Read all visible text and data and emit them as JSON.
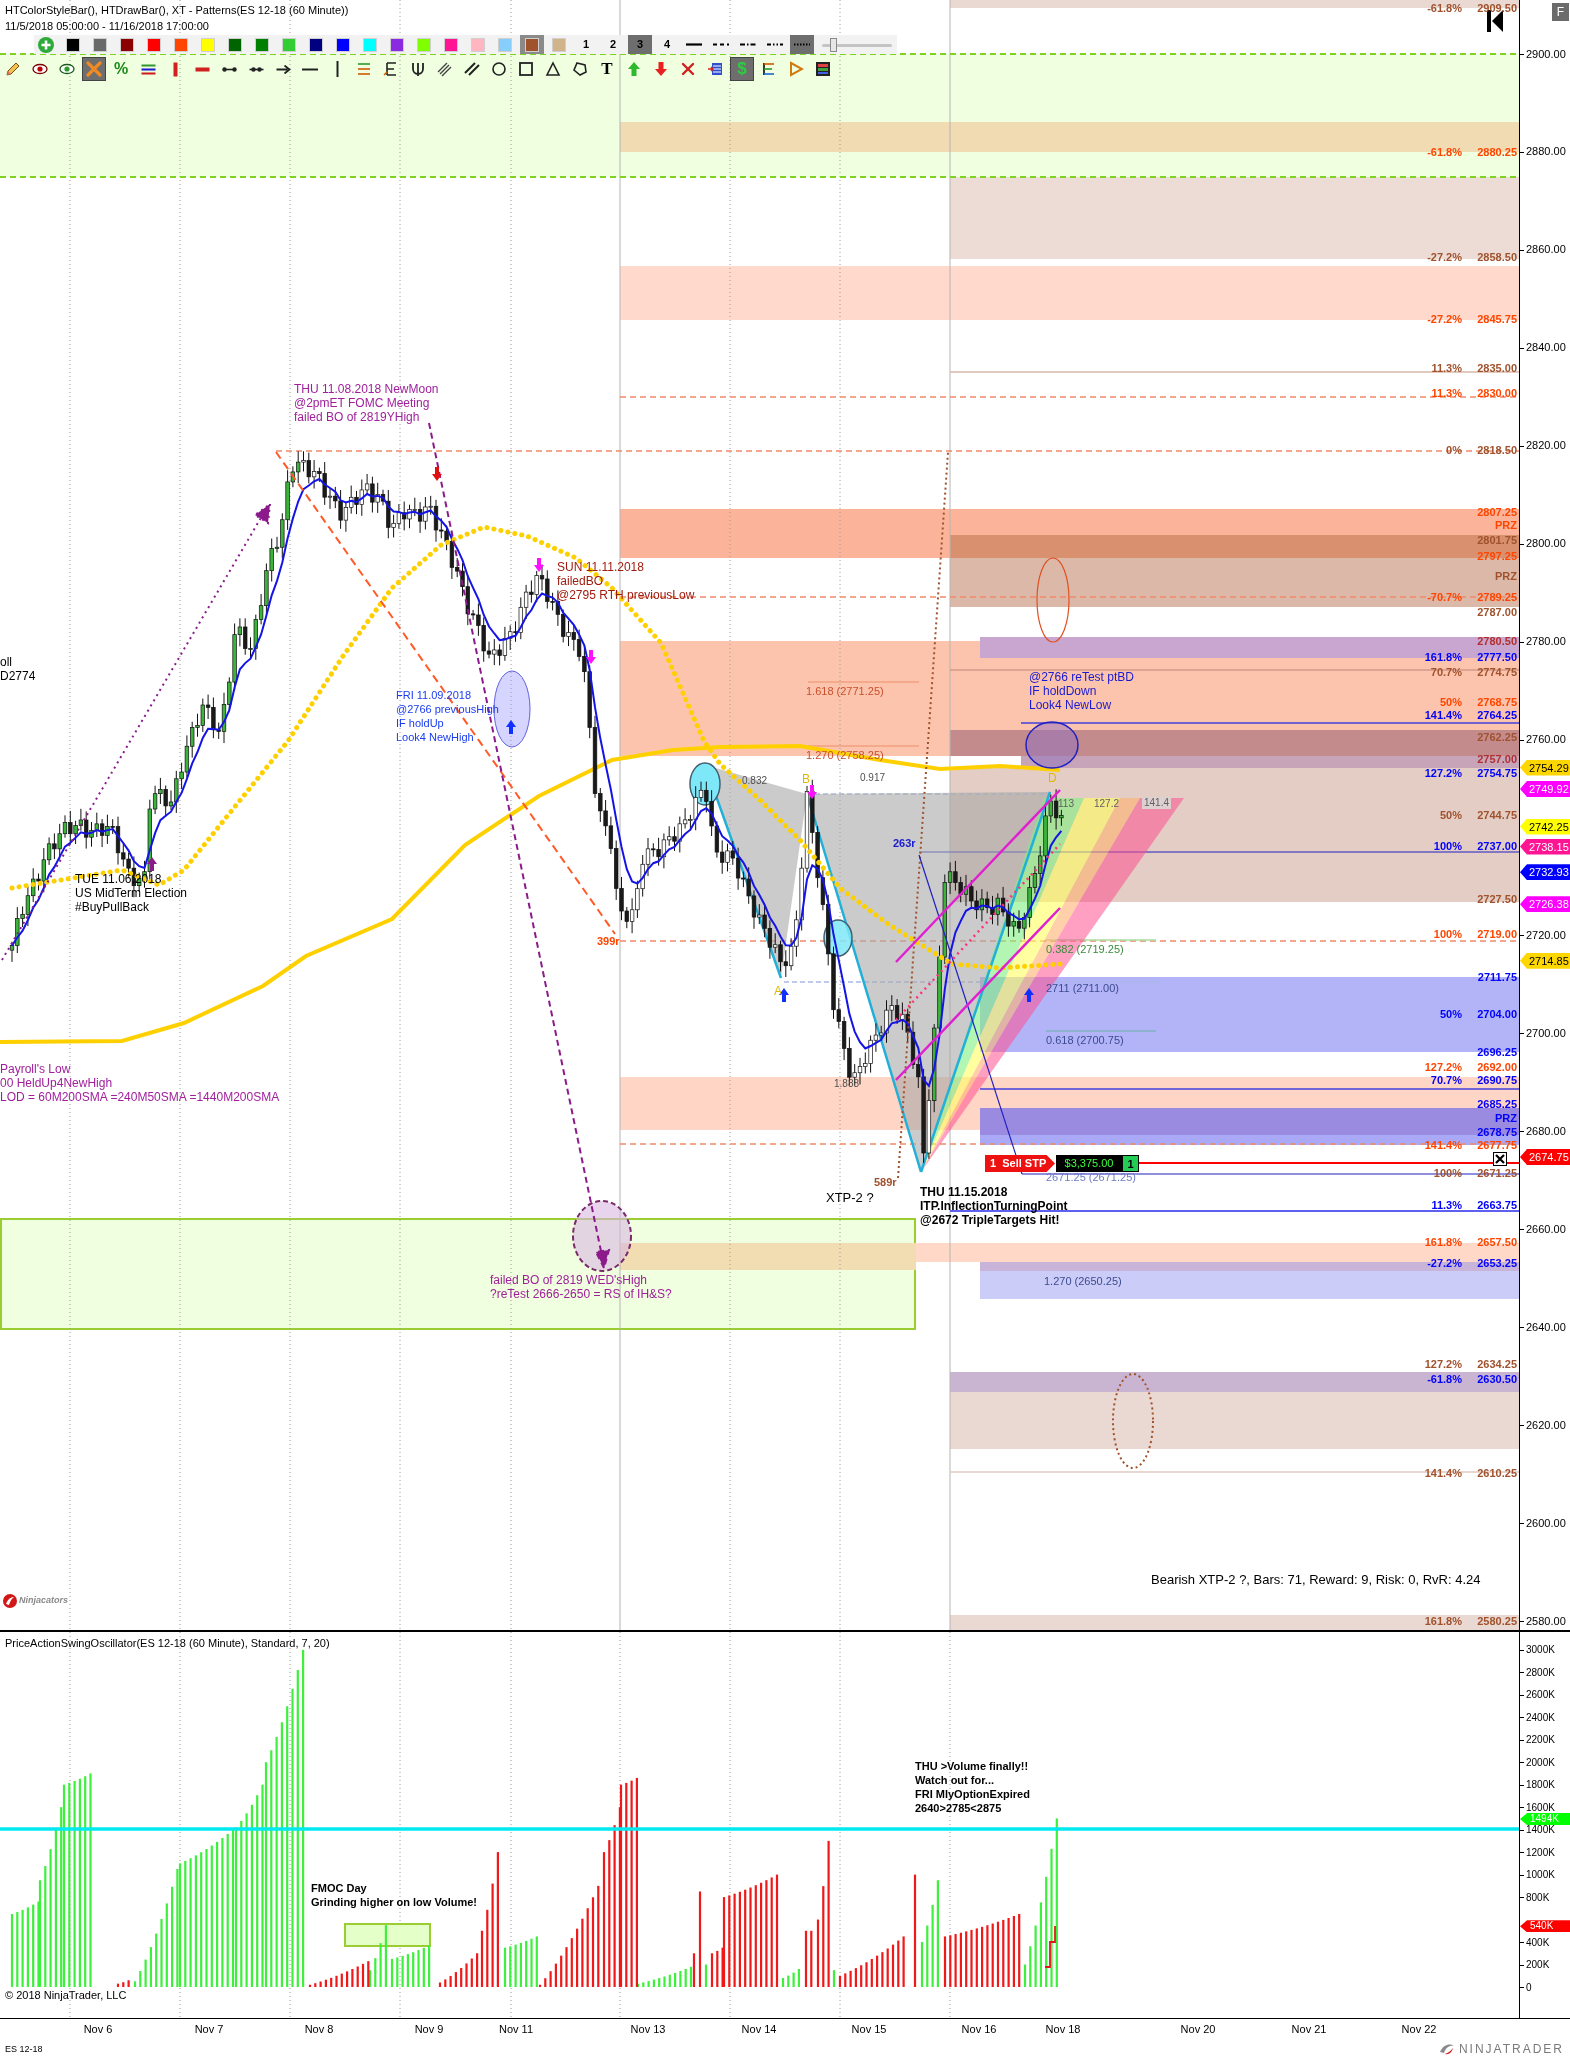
{
  "header": {
    "indicators": "HTColorStyleBar(), HTDrawBar(), XT - Patterns(ES 12-18 (60 Minute))",
    "range": "11/5/2018 05:00:00 - 11/16/2018 17:00:00"
  },
  "toolbar": {
    "swatches": [
      {
        "color": "#000000",
        "selected": false
      },
      {
        "color": "#696969",
        "selected": false
      },
      {
        "color": "#8b0000",
        "selected": false
      },
      {
        "color": "#ff0000",
        "selected": false
      },
      {
        "color": "#ff4500",
        "selected": false
      },
      {
        "color": "#ffff00",
        "selected": false
      },
      {
        "color": "#006400",
        "selected": false
      },
      {
        "color": "#008000",
        "selected": false
      },
      {
        "color": "#32cd32",
        "selected": false
      },
      {
        "color": "#000080",
        "selected": false
      },
      {
        "color": "#0000ff",
        "selected": false
      },
      {
        "color": "#00ffff",
        "selected": false
      },
      {
        "color": "#8a2be2",
        "selected": false
      },
      {
        "color": "#7fff00",
        "selected": false
      },
      {
        "color": "#ff1493",
        "selected": false
      },
      {
        "color": "#ffb6c1",
        "selected": false
      },
      {
        "color": "#87cefa",
        "selected": false
      },
      {
        "color": "#a0522d",
        "selected": true
      },
      {
        "color": "#d2b48c",
        "selected": false
      }
    ],
    "widths": [
      {
        "label": "1",
        "selected": false
      },
      {
        "label": "2",
        "selected": false
      },
      {
        "label": "3",
        "selected": true
      },
      {
        "label": "4",
        "selected": false
      }
    ],
    "line_styles": [
      {
        "kind": "solid",
        "selected": false
      },
      {
        "kind": "dash",
        "selected": false
      },
      {
        "kind": "dashdot",
        "selected": false
      },
      {
        "kind": "dashdotdot",
        "selected": false
      },
      {
        "kind": "dot",
        "selected": true
      }
    ],
    "size_slider": {
      "level": 0.15
    },
    "tools": [
      {
        "kind": "pencil",
        "selected": false
      },
      {
        "kind": "hide",
        "selected": false
      },
      {
        "kind": "show",
        "selected": false
      },
      {
        "kind": "erase",
        "selected": true
      },
      {
        "kind": "percent",
        "label": "%",
        "selected": false
      },
      {
        "kind": "bands",
        "selected": false
      },
      {
        "kind": "vbar",
        "selected": false
      },
      {
        "kind": "hbar",
        "selected": false
      },
      {
        "kind": "segment",
        "selected": false
      },
      {
        "kind": "extended",
        "selected": false
      },
      {
        "kind": "arrow",
        "selected": false
      },
      {
        "kind": "hline",
        "selected": false
      },
      {
        "kind": "vline",
        "selected": false
      },
      {
        "kind": "fib",
        "selected": false
      },
      {
        "kind": "fibext",
        "selected": false
      },
      {
        "kind": "pitchfork",
        "selected": false
      },
      {
        "kind": "triplelines",
        "selected": false
      },
      {
        "kind": "parallel",
        "selected": false
      },
      {
        "kind": "circle",
        "selected": false
      },
      {
        "kind": "square",
        "selected": false
      },
      {
        "kind": "triangle",
        "selected": false
      },
      {
        "kind": "polygon",
        "selected": false
      },
      {
        "kind": "text",
        "label": "T",
        "selected": false
      },
      {
        "kind": "uparrow",
        "selected": false
      },
      {
        "kind": "downarrow",
        "selected": false
      },
      {
        "kind": "remove",
        "selected": false
      },
      {
        "kind": "region",
        "selected": false
      },
      {
        "kind": "dollar",
        "label": "$",
        "selected": true
      },
      {
        "kind": "etime",
        "selected": false
      },
      {
        "kind": "play",
        "selected": false
      },
      {
        "kind": "gradient",
        "selected": false
      }
    ]
  },
  "top_right": {
    "panel_button": "F"
  },
  "chart": {
    "annotations": [
      {
        "lines": [
          "THU 11.08.2018 NewMoon",
          "@2pmET FOMC Meeting",
          "failed BO of 2819YHigh"
        ],
        "color": "#a0209c"
      },
      {
        "lines": [
          "SUN 11.11.2018",
          "failedBO",
          "@2795 RTH previousLow"
        ],
        "color": "#a01c10"
      },
      {
        "lines": [
          "FRI 11.09.2018",
          "@2766 previousHigh",
          "IF holdUp",
          "Look4 NewHigh"
        ],
        "color": "#1a3cf0"
      },
      {
        "lines": [
          "TUE 11.06.2018",
          "US MidTerm Election",
          "#BuyPullBack"
        ],
        "color": "#000000"
      },
      {
        "lines": [
          "oll",
          "D2774"
        ],
        "color": "#000000"
      },
      {
        "lines": [
          "Payroll's Low",
          "00 HeldUp4NewHigh",
          "LOD = 60M200SMA =240M50SMA =1440M200SMA"
        ],
        "color": "#a0209c"
      },
      {
        "lines": [
          "failed BO of 2819 WED'sHigh",
          "?reTest 2666-2650 = RS of IH&S?"
        ],
        "color": "#a0209c"
      },
      {
        "lines": [
          "399r"
        ],
        "color": "#ff4500"
      },
      {
        "lines": [
          "@2766 reTest ptBD",
          "IF holdDown",
          "Look4 NewLow"
        ],
        "color": "#1a1ad0"
      },
      {
        "lines": [
          "263r"
        ],
        "color": "#1a1ad0"
      },
      {
        "lines": [
          "589r"
        ],
        "color": "#a0522d"
      },
      {
        "lines": [
          "XTP-2 ?"
        ],
        "color": "#000000"
      },
      {
        "lines": [
          "THU 11.15.2018",
          "ITP.InflectionTurningPoint",
          "@2672 TripleTargets Hit!"
        ],
        "color": "#000000"
      }
    ],
    "pattern_points": [
      "B",
      "A",
      "D"
    ],
    "pattern_ratios": [
      "0.832",
      "0.917",
      "1.888"
    ],
    "pattern_fibs": [
      {
        "text": "1.618 (2771.25)",
        "color": "#c8502a"
      },
      {
        "text": "1.270 (2758.25)",
        "color": "#c8502a"
      },
      {
        "text": "0.382 (2719.25)",
        "color": "#3c8a3c"
      },
      {
        "text": "2711 (2711.00)",
        "color": "#3c4c90"
      },
      {
        "text": "0.618 (2700.75)",
        "color": "#3c4c90"
      },
      {
        "text": "2671.25 (2671.25)",
        "color": "#6c7cc0"
      },
      {
        "text": "1.270 (2650.25)",
        "color": "#3c4c90"
      }
    ],
    "extensions": [
      "113",
      "127.2",
      "141.4"
    ],
    "order": {
      "quantity": "1",
      "action": "Sell STP",
      "value": "$3,375.00",
      "filled": "1"
    },
    "fib_levels": [
      {
        "kind": "level",
        "percent": "-61.8%",
        "price": "2909.50",
        "color": "#a0522d"
      },
      {
        "kind": "level",
        "percent": "-61.8%",
        "price": "2880.25",
        "color": "#ff4500"
      },
      {
        "kind": "level",
        "percent": "-27.2%",
        "price": "2858.50",
        "color": "#a0522d"
      },
      {
        "kind": "level",
        "percent": "-27.2%",
        "price": "2845.75",
        "color": "#ff4500"
      },
      {
        "kind": "level",
        "percent": "11.3%",
        "price": "2835.00",
        "color": "#a0522d"
      },
      {
        "kind": "level",
        "percent": "11.3%",
        "price": "2830.00",
        "color": "#ff4500"
      },
      {
        "kind": "level",
        "percent": "0%",
        "price": "2818.50",
        "color": "#a0522d"
      },
      {
        "kind": "level",
        "price": "2807.25",
        "color": "#ff4500"
      },
      {
        "kind": "tag",
        "text": "PRZ",
        "color": "#ff4500"
      },
      {
        "kind": "level",
        "price": "2801.75",
        "color": "#a0522d"
      },
      {
        "kind": "level",
        "price": "2797.25",
        "color": "#ff4500"
      },
      {
        "kind": "tag",
        "text": "PRZ",
        "color": "#a0522d"
      },
      {
        "kind": "level",
        "percent": "-70.7%",
        "price": "2789.25",
        "color": "#ff4500"
      },
      {
        "kind": "level",
        "price": "2787.00",
        "color": "#a0522d"
      },
      {
        "kind": "level",
        "price": "2780.50",
        "color": "#b03030"
      },
      {
        "kind": "level",
        "percent": "161.8%",
        "price": "2777.50",
        "color": "#0000ff"
      },
      {
        "kind": "level",
        "percent": "70.7%",
        "price": "2774.75",
        "color": "#a0522d"
      },
      {
        "kind": "level",
        "percent": "50%",
        "price": "2768.75",
        "color": "#ff4500"
      },
      {
        "kind": "level",
        "percent": "141.4%",
        "price": "2764.25",
        "color": "#0000ff"
      },
      {
        "kind": "level",
        "price": "2762.25",
        "color": "#a0522d"
      },
      {
        "kind": "level",
        "price": "2757.00",
        "color": "#b03030"
      },
      {
        "kind": "level",
        "percent": "127.2%",
        "price": "2754.75",
        "color": "#0000ff"
      },
      {
        "kind": "level",
        "percent": "50%",
        "price": "2744.75",
        "color": "#a0522d"
      },
      {
        "kind": "level",
        "percent": "100%",
        "price": "2737.00",
        "color": "#0000ff"
      },
      {
        "kind": "level",
        "price": "2727.50",
        "color": "#a0522d"
      },
      {
        "kind": "level",
        "percent": "100%",
        "price": "2719.00",
        "color": "#ff4500"
      },
      {
        "kind": "level",
        "price": "2711.75",
        "color": "#0000ff"
      },
      {
        "kind": "level",
        "percent": "50%",
        "price": "2704.00",
        "color": "#0000ff"
      },
      {
        "kind": "level",
        "price": "2696.25",
        "color": "#0000ff"
      },
      {
        "kind": "level",
        "percent": "127.2%",
        "price": "2692.00",
        "color": "#ff4500"
      },
      {
        "kind": "level",
        "percent": "70.7%",
        "price": "2690.75",
        "color": "#0000ff"
      },
      {
        "kind": "level",
        "price": "2685.25",
        "color": "#0000ff"
      },
      {
        "kind": "tag",
        "text": "PRZ",
        "color": "#0000ff"
      },
      {
        "kind": "level",
        "price": "2678.75",
        "color": "#0000ff"
      },
      {
        "kind": "level",
        "percent": "141.4%",
        "price": "2677.75",
        "color": "#ff4500"
      },
      {
        "kind": "level",
        "percent": "100%",
        "price": "2671.25",
        "color": "#a0522d"
      },
      {
        "kind": "level",
        "percent": "11.3%",
        "price": "2663.75",
        "color": "#0000ff"
      },
      {
        "kind": "level",
        "percent": "161.8%",
        "price": "2657.50",
        "color": "#ff4500"
      },
      {
        "kind": "level",
        "percent": "-27.2%",
        "price": "2653.25",
        "color": "#0000ff"
      },
      {
        "kind": "level",
        "percent": "127.2%",
        "price": "2634.25",
        "color": "#a0522d"
      },
      {
        "kind": "level",
        "percent": "-61.8%",
        "price": "2630.50",
        "color": "#0000ff"
      },
      {
        "kind": "level",
        "percent": "141.4%",
        "price": "2610.25",
        "color": "#a0522d"
      },
      {
        "kind": "level",
        "percent": "161.8%",
        "price": "2580.25",
        "color": "#a0522d"
      }
    ],
    "summary": "Bearish XTP-2 ?, Bars: 71, Reward: 9, Risk: 0, RvR: 4.24",
    "vendor_logo": "Ninjacators",
    "price_ticks": [
      "2900.00",
      "2880.00",
      "2860.00",
      "2840.00",
      "2820.00",
      "2800.00",
      "2780.00",
      "2760.00",
      "2720.00",
      "2700.00",
      "2680.00",
      "2660.00",
      "2640.00",
      "2620.00",
      "2600.00",
      "2580.00"
    ],
    "price_tags": [
      {
        "text": "2754.29",
        "color": "#ffd700"
      },
      {
        "text": "2749.92",
        "color": "#ff00ff"
      },
      {
        "text": "2742.25",
        "color": "#ffff00"
      },
      {
        "text": "2738.15",
        "color": "#ff1493"
      },
      {
        "text": "2732.93",
        "color": "#0000ff"
      },
      {
        "text": "2726.38",
        "color": "#ff00ff"
      },
      {
        "text": "2714.85",
        "color": "#ffd700"
      },
      {
        "text": "2674.75",
        "color": "#ff0000"
      }
    ]
  },
  "oscillator": {
    "title": "PriceActionSwingOscillator(ES 12-18 (60 Minute), Standard, 7, 20)",
    "notes": [
      {
        "lines": [
          "FMOC Day",
          "Grinding higher on low Volume!"
        ]
      },
      {
        "lines": [
          "THU >Volume finally!!",
          "Watch out for...",
          "FRI MlyOptionExpired",
          "2640>2785<2875"
        ]
      }
    ],
    "copyright": "© 2018 NinjaTrader, LLC",
    "ticks": [
      "3000K",
      "2800K",
      "2600K",
      "2400K",
      "2200K",
      "2000K",
      "1800K",
      "1600K",
      "1400K",
      "1200K",
      "1000K",
      "800K",
      "400K",
      "200K",
      "0"
    ],
    "tags": [
      {
        "text": "1494K",
        "color": "#00ff00"
      },
      {
        "text": "540K",
        "color": "#ff0000"
      }
    ]
  },
  "time_axis": [
    "Nov 6",
    "Nov 7",
    "Nov 8",
    "Nov 9",
    "Nov 11",
    "Nov 13",
    "Nov 14",
    "Nov 15",
    "Nov 16",
    "Nov 18",
    "Nov 20",
    "Nov 21",
    "Nov 22"
  ],
  "footer": {
    "instrument": "ES 12-18",
    "brand": "NINJATRADER"
  }
}
